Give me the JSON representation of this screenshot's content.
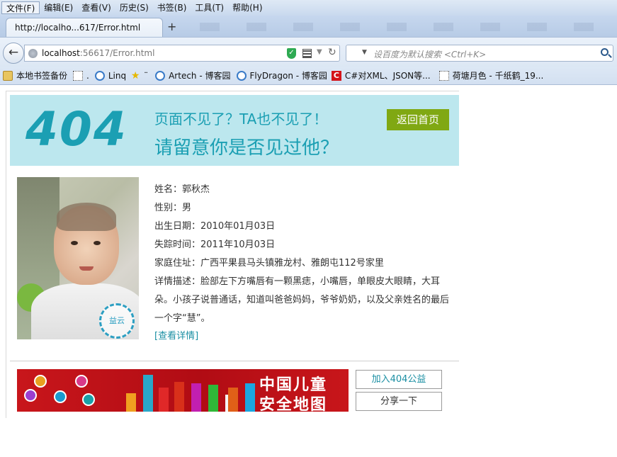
{
  "menu": [
    "文件(F)",
    "编辑(E)",
    "查看(V)",
    "历史(S)",
    "书签(B)",
    "工具(T)",
    "帮助(H)"
  ],
  "tab": {
    "title": "http://localho...617/Error.html",
    "new_tab": "+"
  },
  "nav": {
    "url_host": "localhost",
    "url_rest": ":56617/Error.html",
    "search_placeholder": "设百度为默认搜索 <Ctrl+K>"
  },
  "bookmarks": [
    {
      "label": "本地书签备份",
      "icon": "folder-icon"
    },
    {
      "label": ".",
      "icon": "blank-page-icon"
    },
    {
      "label": "Linq",
      "icon": "cnblogs-icon"
    },
    {
      "label": "¨",
      "icon": "star-icon"
    },
    {
      "label": "Artech - 博客园",
      "icon": "cnblogs-icon"
    },
    {
      "label": "FlyDragon - 博客园",
      "icon": "cnblogs-icon"
    },
    {
      "label": "C#对XML、JSON等...",
      "icon": "red-c-icon"
    },
    {
      "label": "荷塘月色 - 千纸鹤_19...",
      "icon": "blank-page-icon"
    }
  ],
  "hero": {
    "code": "404",
    "line1": "页面不见了？TA也不见了！",
    "line2": "请留意你是否见过他？",
    "home_button": "返回首页"
  },
  "photo": {
    "stamp": "益云"
  },
  "person": {
    "name": "姓名：郭秋杰",
    "gender": "性别：男",
    "birth": "出生日期：2010年01月03日",
    "missing": "失踪时间：2011年10月03日",
    "address": "家庭住址：广西平果县马头镇雅龙村、雅朗屯112号家里",
    "description": "详情描述：脸部左下方嘴唇有一颗黑痣，小嘴唇，单眼皮大眼睛，大耳朵。小孩子说普通话，知道叫爸爸妈妈，爷爷奶奶，以及父亲姓名的最后一个字“慧”。",
    "details_link": "[查看详情]"
  },
  "banner": {
    "title_line1": "中国儿童",
    "title_line2": "安全地图"
  },
  "buttons": {
    "join": "加入404公益",
    "share": "分享一下"
  }
}
